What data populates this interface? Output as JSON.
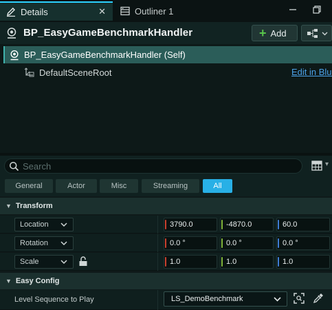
{
  "tabs": {
    "details": {
      "label": "Details",
      "close": "✕"
    },
    "outliner": {
      "label": "Outliner 1"
    }
  },
  "header": {
    "title": "BP_EasyGameBenchmarkHandler",
    "add_label": "Add"
  },
  "tree": {
    "self_label": "BP_EasyGameBenchmarkHandler (Self)",
    "root_label": "DefaultSceneRoot",
    "edit_link": "Edit in Blue"
  },
  "search": {
    "placeholder": "Search",
    "value": ""
  },
  "filters": [
    "General",
    "Actor",
    "Misc",
    "Streaming",
    "All"
  ],
  "active_filter": "All",
  "sections": {
    "transform": "Transform",
    "easy_config": "Easy Config"
  },
  "transform": {
    "location": {
      "label": "Location",
      "x": "3790.0",
      "y": "-4870.0",
      "z": "60.0"
    },
    "rotation": {
      "label": "Rotation",
      "x": "0.0 °",
      "y": "0.0 °",
      "z": "0.0 °"
    },
    "scale": {
      "label": "Scale",
      "x": "1.0",
      "y": "1.0",
      "z": "1.0"
    }
  },
  "easy_config": {
    "level_sequence_label": "Level Sequence to Play",
    "level_sequence_value": "LS_DemoBenchmark"
  },
  "colors": {
    "accent": "#28b0e6",
    "axis_x": "#c9412f",
    "axis_y": "#7fb43a",
    "axis_z": "#3f7ed6",
    "add_plus": "#59c64b",
    "link": "#4aa0e6"
  }
}
